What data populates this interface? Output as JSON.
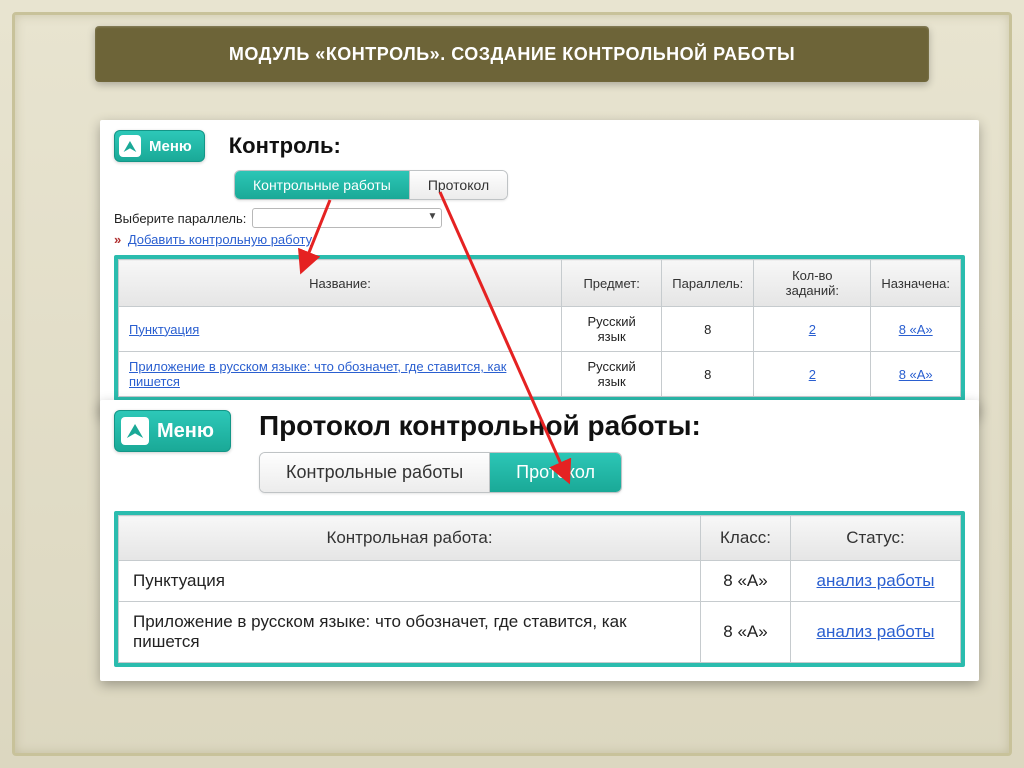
{
  "slide_title": "МОДУЛЬ «КОНТРОЛЬ». СОЗДАНИЕ КОНТРОЛЬНОЙ РАБОТЫ",
  "panel1": {
    "menu_label": "Меню",
    "title": "Контроль:",
    "tabs": {
      "works": "Контрольные работы",
      "protocol": "Протокол"
    },
    "filter_label": "Выберите параллель:",
    "add_link": "Добавить контрольную работу",
    "columns": {
      "name": "Название:",
      "subject": "Предмет:",
      "parallel": "Параллель:",
      "tasks": "Кол-во заданий:",
      "assigned": "Назначена:"
    },
    "rows": [
      {
        "name": "Пунктуация",
        "subject": "Русский язык",
        "parallel": "8",
        "tasks": "2",
        "assigned": "8 «А»"
      },
      {
        "name": "Приложение в русском языке: что обозначет, где ставится, как пишется",
        "subject": "Русский язык",
        "parallel": "8",
        "tasks": "2",
        "assigned": "8 «А»"
      }
    ]
  },
  "panel2": {
    "menu_label": "Меню",
    "title": "Протокол контрольной работы:",
    "tabs": {
      "works": "Контрольные работы",
      "protocol": "Протокол"
    },
    "columns": {
      "name": "Контрольная работа:",
      "class": "Класс:",
      "status": "Статус:"
    },
    "rows": [
      {
        "name": "Пунктуация",
        "class": "8 «А»",
        "status": "анализ работы"
      },
      {
        "name": "Приложение в русском языке: что обозначет, где ставится, как пишется",
        "class": "8 «А»",
        "status": "анализ работы"
      }
    ]
  }
}
